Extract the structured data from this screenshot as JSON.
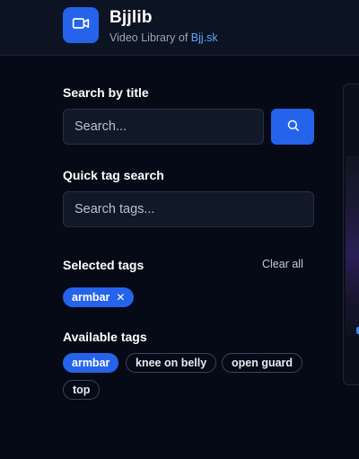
{
  "header": {
    "title": "Bjjlib",
    "subtitle_prefix": "Video Library of ",
    "subtitle_link": "Bjj.sk",
    "logo_icon": "video-camera-icon",
    "accent": "#2563eb"
  },
  "search": {
    "label": "Search by title",
    "placeholder": "Search...",
    "value": "",
    "button_icon": "search-icon"
  },
  "tag_search": {
    "label": "Quick tag search",
    "placeholder": "Search tags...",
    "value": ""
  },
  "selected": {
    "label": "Selected tags",
    "clear_label": "Clear all",
    "tags": [
      {
        "label": "armbar",
        "remove_icon": "close-icon"
      }
    ]
  },
  "available": {
    "label": "Available tags",
    "tags": [
      {
        "label": "armbar",
        "active": true
      },
      {
        "label": "knee on belly",
        "active": false
      },
      {
        "label": "open guard",
        "active": false
      },
      {
        "label": "top",
        "active": false
      }
    ]
  }
}
